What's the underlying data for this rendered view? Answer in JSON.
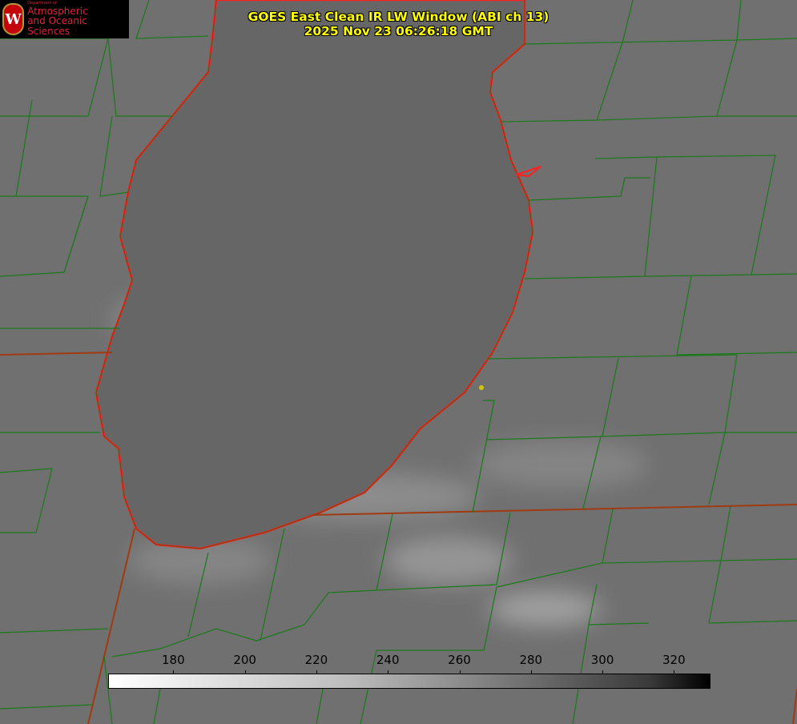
{
  "title": {
    "line1": "GOES East Clean IR LW Window (ABI ch 13)",
    "line2": "2025 Nov 23 06:26:18 GMT"
  },
  "logo": {
    "department": "Department of",
    "line1": "Atmospheric",
    "line2": "and Oceanic Sciences",
    "seal_letter": "W"
  },
  "colorbar": {
    "min": 162,
    "max": 330,
    "ticks": [
      "180",
      "200",
      "220",
      "240",
      "260",
      "280",
      "300",
      "320"
    ],
    "colormap": "white-to-black (inverted grayscale)"
  },
  "colors": {
    "county_lines": "#1a7a1a",
    "state_lines": "#8a3a10",
    "coastline": "#ff2020",
    "title_text": "#ffff00",
    "marker": "#d4c400"
  }
}
